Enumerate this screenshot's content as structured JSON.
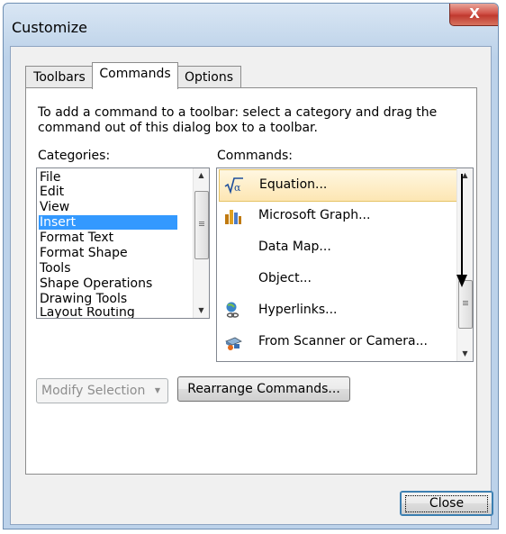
{
  "window": {
    "title": "Customize",
    "close_glyph": "X"
  },
  "tabs": [
    {
      "label": "Toolbars",
      "active": false
    },
    {
      "label": "Commands",
      "active": true
    },
    {
      "label": "Options",
      "active": false
    }
  ],
  "instructions": "To add a command to a toolbar: select a category and drag the command out of this dialog box to a toolbar.",
  "categories": {
    "label": "Categories:",
    "items": [
      "File",
      "Edit",
      "View",
      "Insert",
      "Format Text",
      "Format Shape",
      "Tools",
      "Shape Operations",
      "Drawing Tools",
      "Layout  Routing"
    ],
    "selected": "Insert"
  },
  "commands": {
    "label": "Commands:",
    "items": [
      {
        "label": "Equation...",
        "icon": "equation-icon"
      },
      {
        "label": "Microsoft Graph...",
        "icon": "graph-icon"
      },
      {
        "label": "Data Map...",
        "icon": ""
      },
      {
        "label": "Object...",
        "icon": ""
      },
      {
        "label": "Hyperlinks...",
        "icon": "hyperlink-icon"
      },
      {
        "label": "From Scanner or Camera...",
        "icon": "scanner-camera-icon"
      }
    ],
    "selected": "Equation..."
  },
  "buttons": {
    "modify_selection": "Modify Selection",
    "rearrange_commands": "Rearrange Commands...",
    "close": "Close"
  },
  "colors": {
    "selection_blue": "#3399ff",
    "title_close": "#c0392f",
    "hover_highlight": "#fde6b3"
  }
}
